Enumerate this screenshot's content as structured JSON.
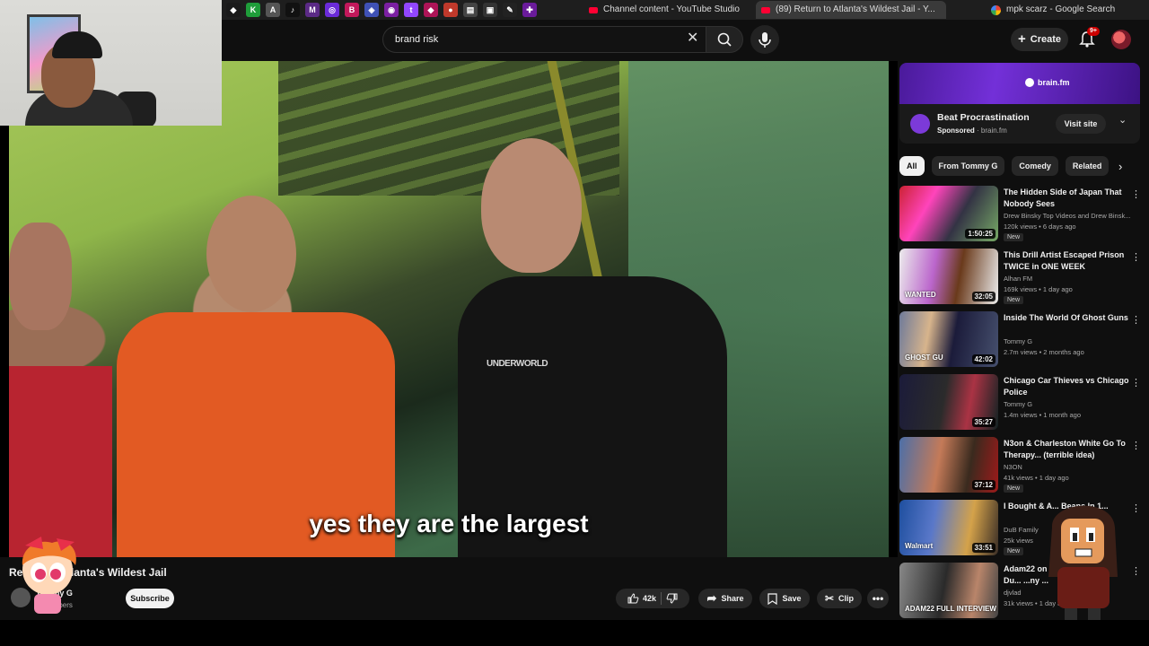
{
  "browser": {
    "favicons": [
      {
        "label": "◆",
        "color": "#1a1a1a"
      },
      {
        "label": "K",
        "color": "#1f9d3a"
      },
      {
        "label": "A",
        "color": "#555"
      },
      {
        "label": "♪",
        "color": "#111"
      },
      {
        "label": "M",
        "color": "#5b2a86"
      },
      {
        "label": "◎",
        "color": "#6b2bd9"
      },
      {
        "label": "B",
        "color": "#c2185b"
      },
      {
        "label": "◈",
        "color": "#3f51b5"
      },
      {
        "label": "◉",
        "color": "#7b1fa2"
      },
      {
        "label": "t",
        "color": "#9146ff"
      },
      {
        "label": "◆",
        "color": "#ad1457"
      },
      {
        "label": "●",
        "color": "#c0392b"
      },
      {
        "label": "▤",
        "color": "#444"
      },
      {
        "label": "▣",
        "color": "#333"
      },
      {
        "label": "✎",
        "color": "#222"
      },
      {
        "label": "✚",
        "color": "#6a1b9a"
      }
    ],
    "tabs": [
      {
        "title": "Channel content - YouTube Studio"
      },
      {
        "title": "(89) Return to Atlanta's Wildest Jail - Y..."
      },
      {
        "title": "mpk scarz - Google Search"
      }
    ]
  },
  "header": {
    "search_value": "brand risk",
    "create_label": "Create",
    "notification_count": "9+"
  },
  "video": {
    "caption": "yes they are the largest",
    "shirt_text": "UNDERWORLD"
  },
  "below": {
    "title": "Return to Atlanta's Wildest Jail",
    "channel": "Tommy G",
    "subscribers": "subscribers",
    "subscribe_label": "Subscribe",
    "likes": "42k",
    "share_label": "Share",
    "save_label": "Save",
    "clip_label": "Clip"
  },
  "ad": {
    "brand": "brain.fm",
    "title": "Beat Procrastination",
    "sponsored": "Sponsored",
    "domain": "brain.fm",
    "visit_label": "Visit site"
  },
  "chips": [
    "All",
    "From Tommy G",
    "Comedy",
    "Related"
  ],
  "sidebar_videos": [
    {
      "title": "The Hidden Side of Japan That Nobody Sees",
      "channel": "Drew Binsky Top Videos and Drew Binsk...",
      "meta": "120k views • 6 days ago",
      "duration": "1:50:25",
      "badge": "New"
    },
    {
      "title": "This Drill Artist Escaped Prison TWICE in ONE WEEK",
      "channel": "Alhan FM",
      "meta": "169k views • 1 day ago",
      "duration": "32:05",
      "badge": "New"
    },
    {
      "title": "Inside The World Of Ghost Guns",
      "channel": "Tommy G",
      "meta": "2.7m views • 2 months ago",
      "duration": "42:02",
      "badge": ""
    },
    {
      "title": "Chicago Car Thieves vs Chicago Police",
      "channel": "Tommy G",
      "meta": "1.4m views • 1 month ago",
      "duration": "35:27",
      "badge": ""
    },
    {
      "title": "N3on & Charleston White Go To Therapy... (terrible idea)",
      "channel": "N3ON",
      "meta": "41k views • 1 day ago",
      "duration": "37:12",
      "badge": "New"
    },
    {
      "title": "I Bought & A... Beans In 1...",
      "channel": "DuB Family",
      "meta": "25k views",
      "duration": "33:51",
      "badge": "New"
    },
    {
      "title": "Adam22 on Ja... Blueface, Lil Du... ...ny ...",
      "channel": "djvlad",
      "meta": "31k views • 1 day ago",
      "duration": "",
      "badge": ""
    }
  ],
  "thumb_texts": [
    "",
    "WANTED",
    "GHOST GU",
    "",
    "",
    "Walmart",
    "ADAM22 FULL INTERVIEW"
  ],
  "colors": {
    "brand_red": "#ff0033",
    "ad_purple": "#7330d8",
    "orange_jumpsuit": "#e25a23"
  }
}
